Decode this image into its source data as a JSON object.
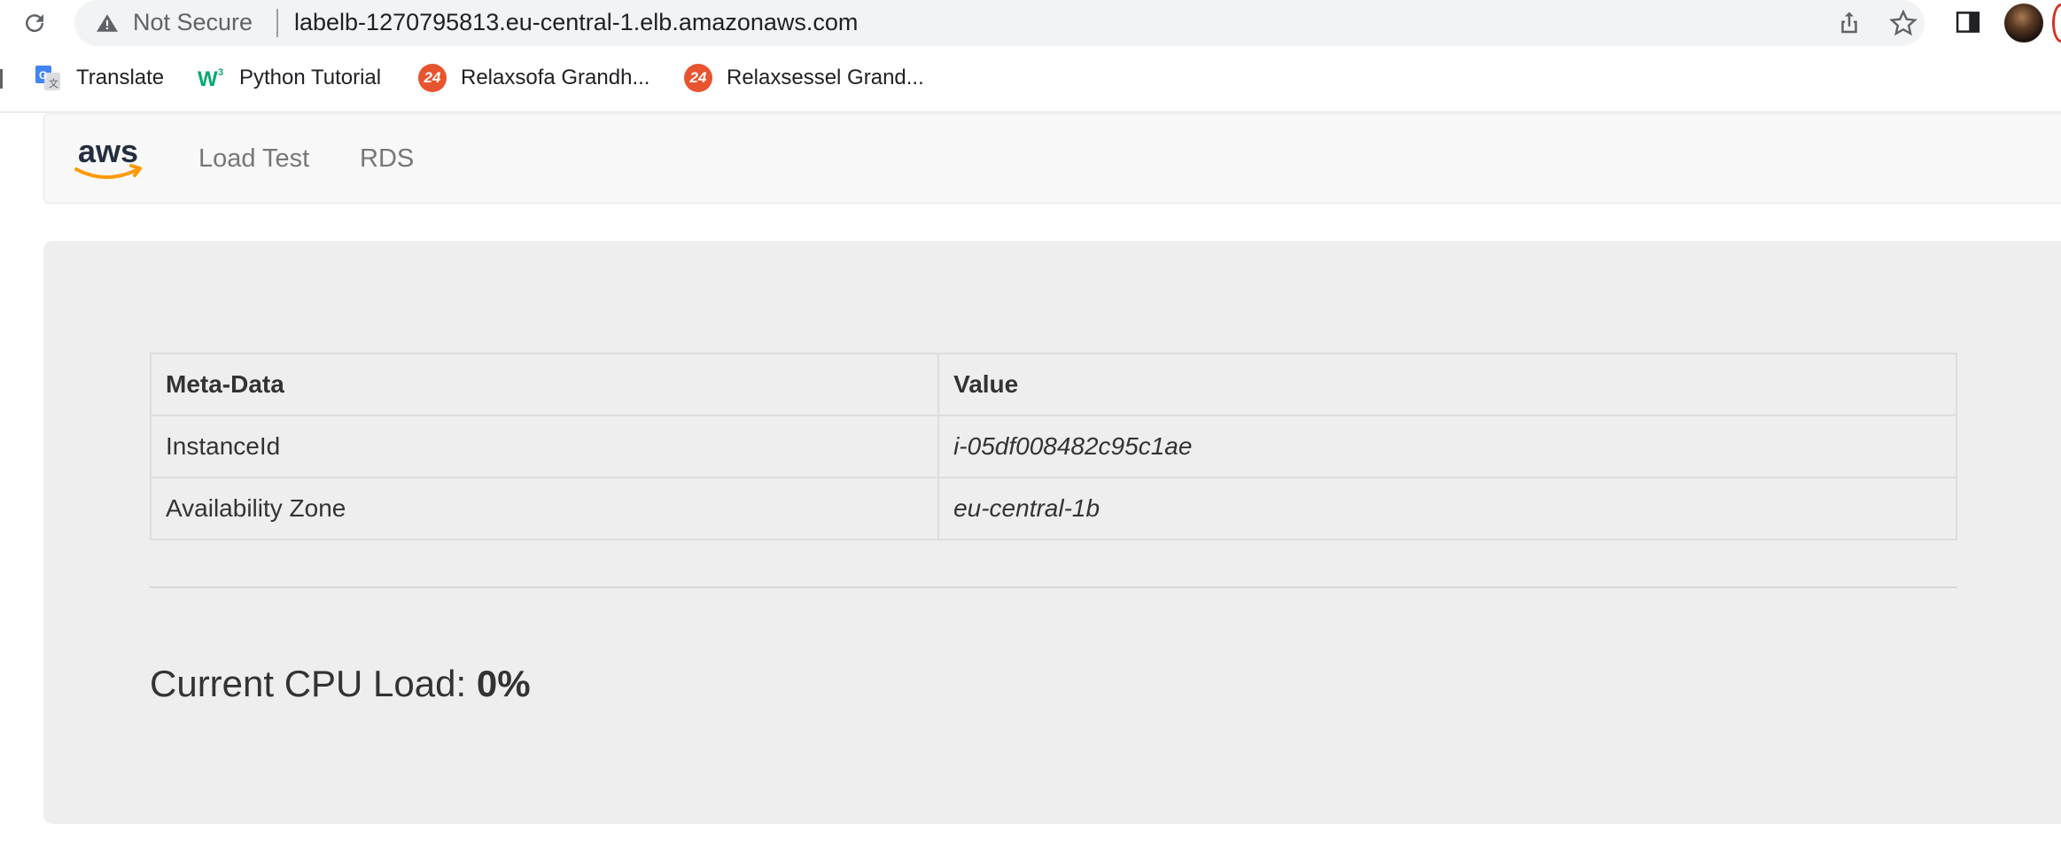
{
  "browser": {
    "security_label": "Not Secure",
    "url": "labelb-1270795813.eu-central-1.elb.amazonaws.com",
    "icons": [
      "reload-icon",
      "warning-icon",
      "share-icon",
      "star-icon",
      "side-panel-icon",
      "profile-avatar"
    ]
  },
  "bookmarks": [
    {
      "label": "Translate",
      "icon": "google-translate-icon"
    },
    {
      "label": "Python Tutorial",
      "icon": "w3schools-icon"
    },
    {
      "label": "Relaxsofa Grandh...",
      "icon": "24-icon",
      "icon_text": "24"
    },
    {
      "label": "Relaxsessel Grand...",
      "icon": "24-icon",
      "icon_text": "24"
    }
  ],
  "navbar": {
    "logo_text": "aws",
    "links": [
      "Load Test",
      "RDS"
    ]
  },
  "metadata_table": {
    "headers": [
      "Meta-Data",
      "Value"
    ],
    "rows": [
      {
        "key": "InstanceId",
        "value": "i-05df008482c95c1ae"
      },
      {
        "key": "Availability Zone",
        "value": "eu-central-1b"
      }
    ]
  },
  "cpu": {
    "label": "Current CPU Load:",
    "value": "0%"
  },
  "colors": {
    "aws_orange": "#ff9900",
    "aws_navy": "#232f3e",
    "favicon_24": "#e8542f"
  }
}
